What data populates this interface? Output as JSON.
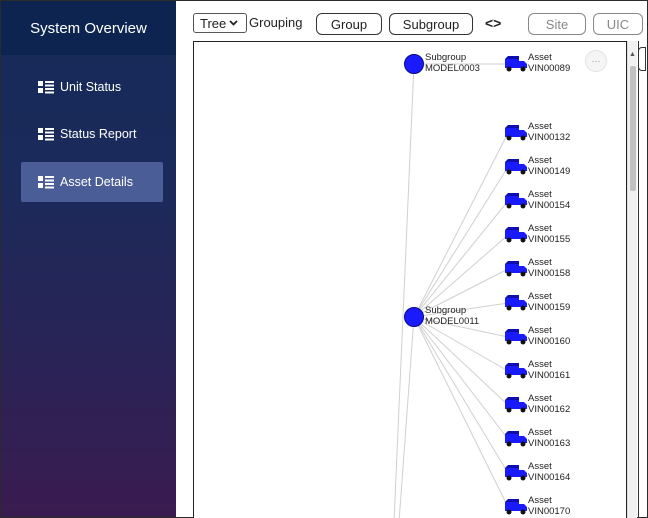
{
  "sidebar": {
    "title": "System Overview",
    "items": [
      {
        "label": "Unit Status",
        "active": false
      },
      {
        "label": "Status Report",
        "active": false
      },
      {
        "label": "Asset Details",
        "active": true
      }
    ]
  },
  "toolbar": {
    "view_select": "Tree",
    "grouping_label": "Grouping",
    "buttons": [
      "Group",
      "Subgroup"
    ],
    "swap_icon": "<>",
    "muted_buttons": [
      "Site",
      "UIC"
    ]
  },
  "tree": {
    "subgroups": [
      {
        "type_label": "Subgroup",
        "name": "MODEL0003"
      },
      {
        "type_label": "Subgroup",
        "name": "MODEL0011"
      }
    ],
    "assets": [
      {
        "type_label": "Asset",
        "vin": "VIN00089"
      },
      {
        "type_label": "Asset",
        "vin": "VIN00132"
      },
      {
        "type_label": "Asset",
        "vin": "VIN00149"
      },
      {
        "type_label": "Asset",
        "vin": "VIN00154"
      },
      {
        "type_label": "Asset",
        "vin": "VIN00155"
      },
      {
        "type_label": "Asset",
        "vin": "VIN00158"
      },
      {
        "type_label": "Asset",
        "vin": "VIN00159"
      },
      {
        "type_label": "Asset",
        "vin": "VIN00160"
      },
      {
        "type_label": "Asset",
        "vin": "VIN00161"
      },
      {
        "type_label": "Asset",
        "vin": "VIN00162"
      },
      {
        "type_label": "Asset",
        "vin": "VIN00163"
      },
      {
        "type_label": "Asset",
        "vin": "VIN00164"
      },
      {
        "type_label": "Asset",
        "vin": "VIN00170"
      }
    ],
    "more_icon": "···",
    "colors": {
      "node": "#1a1aff",
      "link": "#d0d0d0"
    }
  }
}
